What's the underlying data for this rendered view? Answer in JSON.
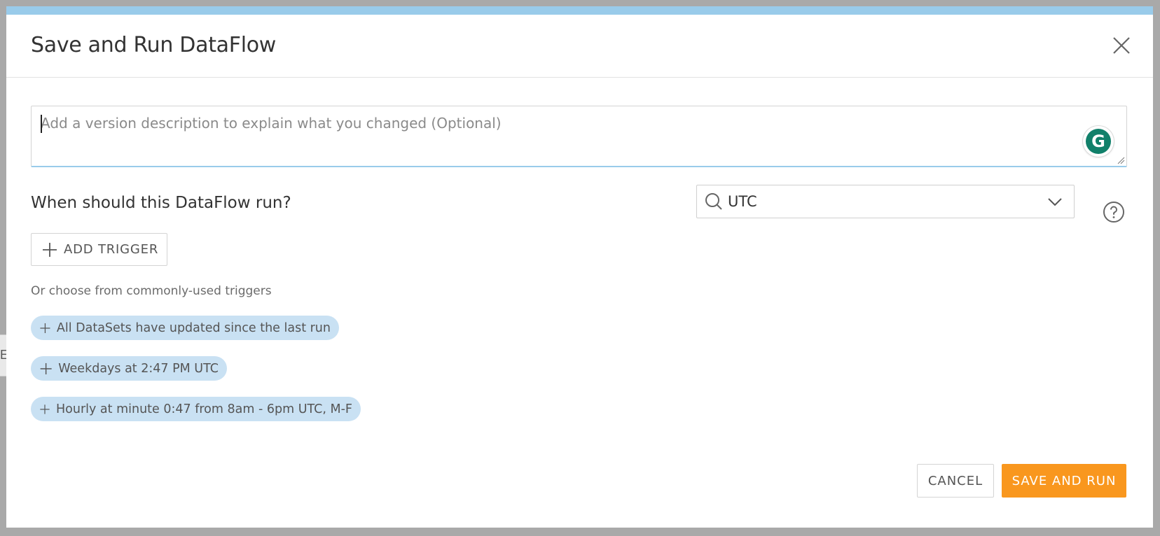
{
  "dialog": {
    "title": "Save and Run DataFlow"
  },
  "description": {
    "placeholder": "Add a version description to explain what you changed (Optional)",
    "value": ""
  },
  "schedule": {
    "question": "When should this DataFlow run?",
    "timezone_value": "UTC",
    "add_trigger_label": "ADD TRIGGER",
    "common_label": "Or choose from commonly-used triggers",
    "suggestions": [
      {
        "label": "All DataSets have updated since the last run"
      },
      {
        "label": "Weekdays at 2:47 PM UTC"
      },
      {
        "label": "Hourly at minute 0:47 from 8am - 6pm UTC, M-F"
      }
    ]
  },
  "footer": {
    "cancel_label": "CANCEL",
    "save_run_label": "SAVE AND RUN"
  },
  "background": {
    "sliver_text": "E"
  },
  "colors": {
    "accent_blue": "#99cbea",
    "chip_bg": "#c9e1f3",
    "primary_orange": "#f9971e",
    "grammarly_green": "#11806a"
  }
}
